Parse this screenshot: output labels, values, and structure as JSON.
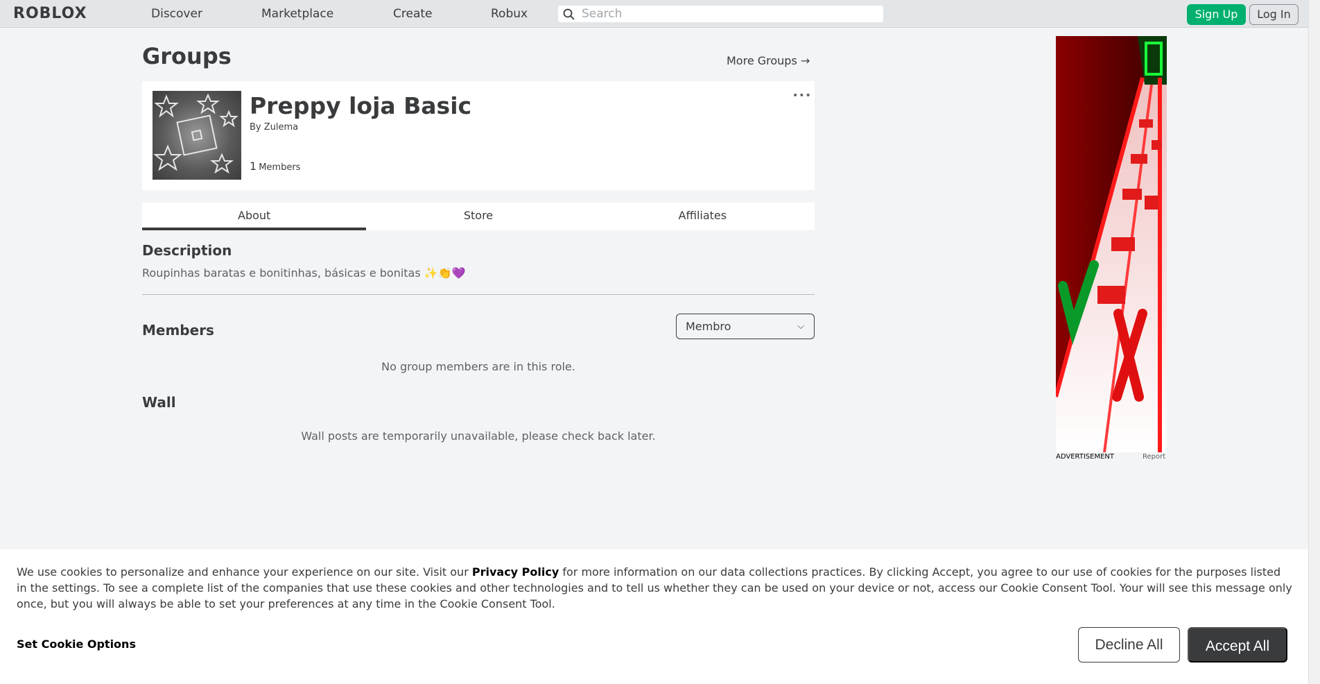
{
  "nav": {
    "logo": "ROBLOX",
    "links": [
      "Discover",
      "Marketplace",
      "Create",
      "Robux"
    ],
    "search_placeholder": "Search",
    "signup_label": "Sign Up",
    "login_label": "Log In"
  },
  "page": {
    "title": "Groups",
    "more_groups": "More Groups →"
  },
  "group": {
    "name": "Preppy loja Basic",
    "by_label": "By",
    "owner": "Zulema",
    "member_count": "1",
    "members_label": "Members",
    "menu_glyph": "•••"
  },
  "tabs": [
    "About",
    "Store",
    "Affiliates"
  ],
  "about": {
    "description_heading": "Description",
    "description_text": "Roupinhas baratas e bonitinhas, básicas e bonitas ✨👏💜",
    "members_heading": "Members",
    "role_selected": "Membro",
    "no_members_msg": "No group members are in this role.",
    "wall_heading": "Wall",
    "wall_msg": "Wall posts are temporarily unavailable, please check back later."
  },
  "ad": {
    "label": "ADVERTISEMENT",
    "report": "Report"
  },
  "cookie": {
    "text_before": "We use cookies to personalize and enhance your experience on our site. Visit our ",
    "policy_link": "Privacy Policy",
    "text_after": " for more information on our data collections practices. By clicking Accept, you agree to our use of cookies for the purposes listed in the settings. To see a complete list of the companies that use these cookies and other technologies and to tell us whether they can be used on your device or not, access our Cookie Consent Tool. Your will see this message only once, but you will always be able to set your preferences at any time in the Cookie Consent Tool.",
    "set_options": "Set Cookie Options",
    "decline": "Decline All",
    "accept": "Accept All"
  }
}
